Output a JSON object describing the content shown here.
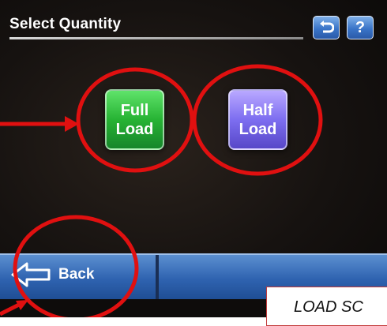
{
  "header": {
    "title": "Select Quantity"
  },
  "toolbar": {
    "help_label": "?"
  },
  "options": [
    {
      "line1": "Full",
      "line2": "Load"
    },
    {
      "line1": "Half",
      "line2": "Load"
    }
  ],
  "footer": {
    "back_label": "Back"
  },
  "callout": {
    "text": "LOAD SC"
  },
  "colors": {
    "highlight": "#e01010",
    "full_load": "#27b334",
    "half_load": "#7d6ef0",
    "bar": "#2f63b0"
  },
  "icons": [
    "undo-icon",
    "help-icon",
    "back-arrow-icon"
  ]
}
